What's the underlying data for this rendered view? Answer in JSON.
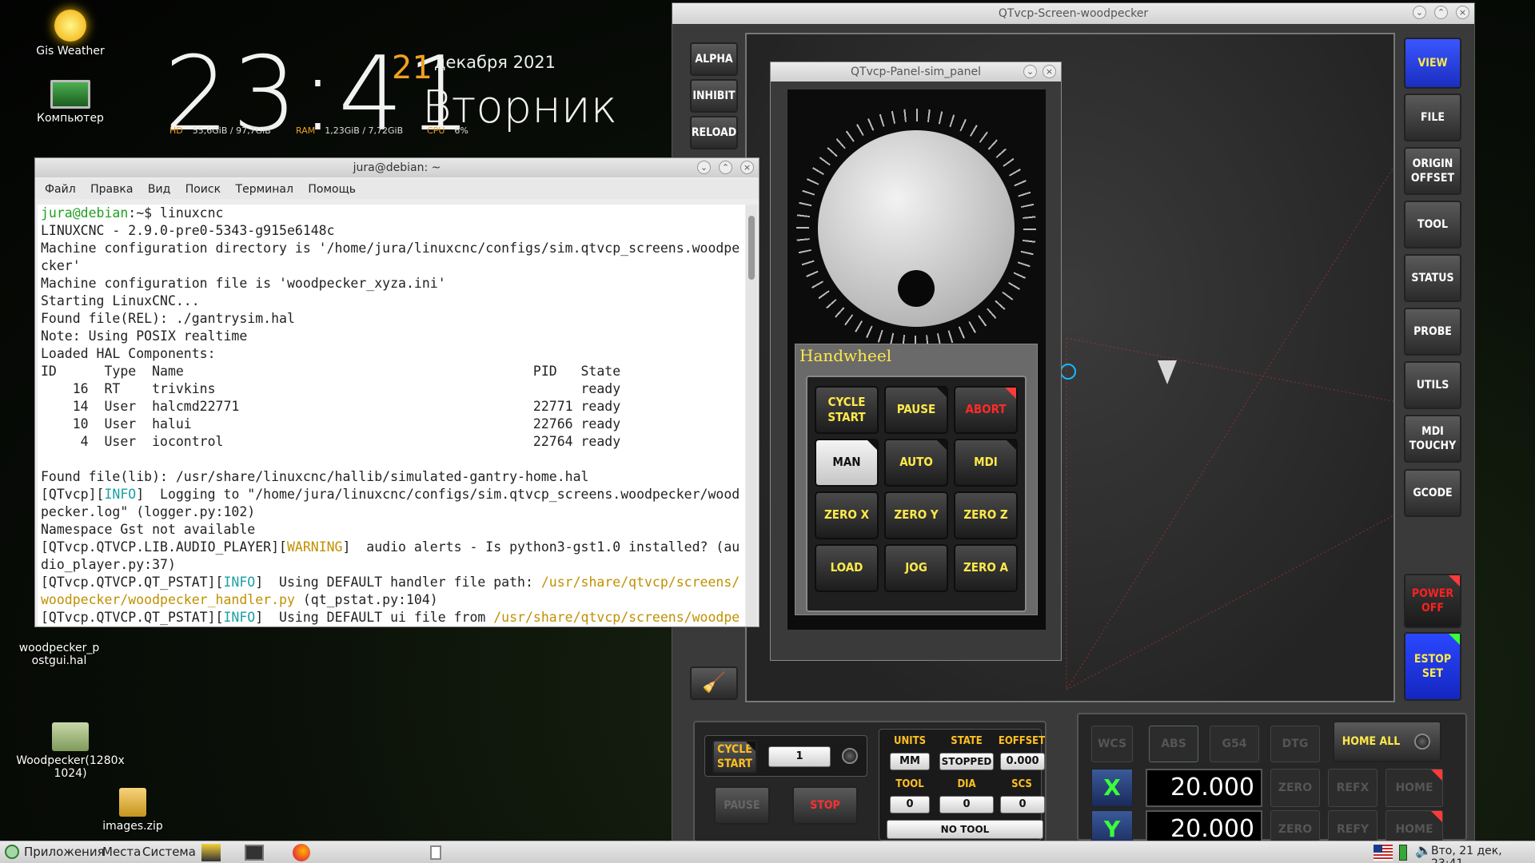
{
  "desktop": {
    "icons": [
      {
        "label": "Gis Weather"
      },
      {
        "label": "Компьютер"
      },
      {
        "label": "woodpecker_postgui.hal"
      },
      {
        "label": "Woodpecker(1280x1024)"
      },
      {
        "label": "images.zip"
      }
    ],
    "clock": {
      "time": "23:41",
      "day": "21",
      "month_year": "декабря 2021",
      "weekday": "Вторник"
    },
    "sysinfo": {
      "hd_label": "HD",
      "hd_value": "55,6GiB / 97,7GiB",
      "ram_label": "RAM",
      "ram_value": "1,23GiB / 7,72GiB",
      "cpu_label": "CPU",
      "cpu_value": "6%"
    }
  },
  "terminal": {
    "title": "jura@debian: ~",
    "menu": [
      "Файл",
      "Правка",
      "Вид",
      "Поиск",
      "Терминал",
      "Помощь"
    ],
    "prompt_user": "jura@debian",
    "prompt_rest": ":~$ linuxcnc",
    "lines": [
      "LINUXCNC - 2.9.0-pre0-5343-g915e6148c",
      "Machine configuration directory is '/home/jura/linuxcnc/configs/sim.qtvcp_screens.woodpe",
      "cker'",
      "Machine configuration file is 'woodpecker_xyza.ini'",
      "Starting LinuxCNC...",
      "Found file(REL): ./gantrysim.hal",
      "Note: Using POSIX realtime",
      "Loaded HAL Components:",
      "ID      Type  Name                                            PID   State",
      "    16  RT    trivkins                                              ready",
      "    14  User  halcmd22771                                     22771 ready",
      "    10  User  halui                                           22766 ready",
      "     4  User  iocontrol                                       22764 ready",
      "",
      "Found file(lib): /usr/share/linuxcnc/hallib/simulated-gantry-home.hal"
    ],
    "log": {
      "l1a": "[QTvcp][",
      "l1b": "INFO",
      "l1c": "]  Logging to \"/home/jura/linuxcnc/configs/sim.qtvcp_screens.woodpecker/wood",
      "l2": "pecker.log\" (logger.py:102)",
      "l3": "Namespace Gst not available",
      "l4a": "[QTvcp.QTVCP.LIB.AUDIO_PLAYER][",
      "l4b": "WARNING",
      "l4c": "]  audio alerts - Is python3-gst1.0 installed? (au",
      "l5": "dio_player.py:37)",
      "l6a": "[QTvcp.QTVCP.QT_PSTAT][",
      "l6b": "INFO",
      "l6c": "]  Using DEFAULT handler file path: ",
      "l6d": "/usr/share/qtvcp/screens/",
      "l7a": "woodpecker/woodpecker_handler.py",
      "l7b": " (qt_pstat.py:104)",
      "l8a": "[QTvcp.QTVCP.QT_PSTAT][",
      "l8b": "INFO",
      "l8c": "]  Using DEFAULT ui file from ",
      "l8d": "/usr/share/qtvcp/screens/woodpe"
    }
  },
  "qtvcp": {
    "title": "QTvcp-Screen-woodpecker",
    "left_buttons": [
      "ALPHA",
      "INHIBIT",
      "RELOAD"
    ],
    "right_buttons": [
      "VIEW",
      "FILE",
      "ORIGIN OFFSET",
      "TOOL",
      "STATUS",
      "PROBE",
      "UTILS",
      "MDI TOUCHY",
      "GCODE"
    ],
    "power": "POWER OFF",
    "estop": "ESTOP SET"
  },
  "panel": {
    "title": "QTvcp-Panel-sim_panel",
    "handwheel_label": "Handwheel",
    "buttons": [
      "CYCLE START",
      "PAUSE",
      "ABORT",
      "MAN",
      "AUTO",
      "MDI",
      "ZERO X",
      "ZERO Y",
      "ZERO Z",
      "LOAD",
      "JOG",
      "ZERO A"
    ]
  },
  "bottom_left": {
    "cycle_start": "CYCLE START",
    "line_value": "1",
    "pause": "PAUSE",
    "stop": "STOP",
    "units_label": "UNITS",
    "units_value": "MM",
    "state_label": "STATE",
    "state_value": "STOPPED",
    "eoffset_label": "EOFFSET",
    "eoffset_value": "0.000",
    "tool_label": "TOOL",
    "tool_value": "0",
    "dia_label": "DIA",
    "dia_value": "0",
    "scs_label": "SCS",
    "scs_value": "0",
    "no_tool": "NO TOOL"
  },
  "dro": {
    "top_buttons": [
      "WCS",
      "ABS",
      "G54",
      "DTG"
    ],
    "home_all": "HOME ALL",
    "axes": [
      {
        "name": "X",
        "value": "20.000",
        "zero": "ZERO",
        "ref": "REFX",
        "home": "HOME"
      },
      {
        "name": "Y",
        "value": "20.000",
        "zero": "ZERO",
        "ref": "REFY",
        "home": "HOME"
      }
    ]
  },
  "taskbar": {
    "menu_apps": "Приложения",
    "menu_places": "Места",
    "menu_system": "Система",
    "datetime": "Вто, 21 дек, 23:41"
  }
}
